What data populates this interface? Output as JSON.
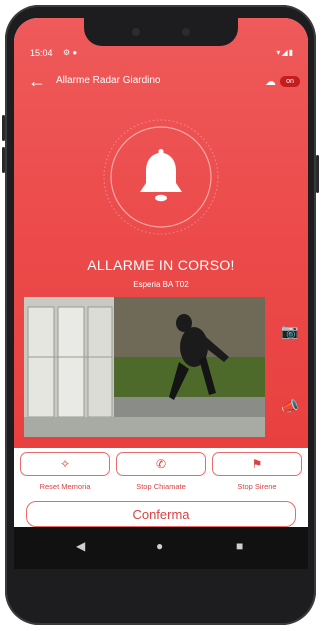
{
  "status_bar": {
    "time": "15:04",
    "left_icons": "⚙ ●",
    "right_icons": "▾◢▮"
  },
  "header": {
    "title": "Allarme Radar Giardino",
    "back_icon": "arrow-left-icon",
    "cloud_icon": "cloud-icon",
    "badge": "on"
  },
  "alarm": {
    "title": "ALLARME IN CORSO!",
    "subtitle": "Esperia   BA T02",
    "icon": "bell-icon"
  },
  "side_actions": {
    "camera_icon": "camera-icon",
    "siren_icon": "megaphone-icon"
  },
  "actions": [
    {
      "label": "Reset Memoria",
      "icon": "reset-memory-icon",
      "glyph": "✧"
    },
    {
      "label": "Stop Chiamate",
      "icon": "stop-calls-icon",
      "glyph": "✆"
    },
    {
      "label": "Stop Sirene",
      "icon": "stop-siren-icon",
      "glyph": "⚑"
    }
  ],
  "confirm_label": "Conferma",
  "nav": {
    "back": "◀",
    "home": "●",
    "recent": "■"
  },
  "colors": {
    "accent": "#e94747",
    "accent_dark": "#c31d1d"
  }
}
